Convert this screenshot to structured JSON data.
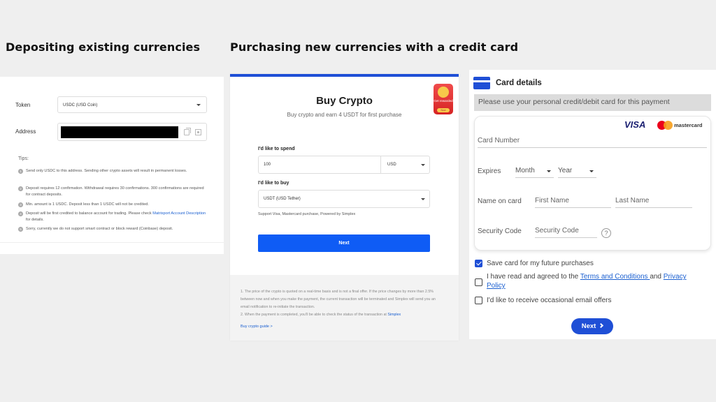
{
  "headings": {
    "left": "Depositing existing currencies",
    "right": "Purchasing new currencies with a credit card"
  },
  "deposit": {
    "token_label": "Token",
    "token_value": "USDC (USD Coin)",
    "address_label": "Address",
    "tips_label": "Tips:",
    "tips": [
      {
        "num": "1",
        "text": "Send only USDC to this address. Sending other crypto assets will result in permanent losses."
      },
      {
        "num": "2",
        "text": "Deposit requires 12 confirmation. Withdrawal requires 30 confirmations. 300 confirmations are required for contract deposits."
      },
      {
        "num": "3",
        "text": "Min. amount is 1 USDC. Deposit less than 1 USDC will not be credited."
      },
      {
        "num": "4",
        "text_prefix": "Deposit will be first credited to balance account for trading. Please check ",
        "link": "Matrixport Account Description",
        "text_suffix": " for details."
      },
      {
        "num": "5",
        "text": "Sorry, currently we do not support smart contract or block reward (Coinbase) deposit."
      }
    ]
  },
  "buy_crypto": {
    "title": "Buy Crypto",
    "subtitle": "Buy crypto and earn 4 USDT for first purchase",
    "promo_text": "Get rewarded",
    "promo_button": "Now",
    "spend_label": "I'd like to spend",
    "spend_value": "100",
    "spend_currency": "USD",
    "buy_label": "I'd like to buy",
    "buy_value": "USDT (USD Tether)",
    "support_text": "Support Visa, Mastercard purchase, Powered by Simplex",
    "next_label": "Next",
    "note_1": "1. The price of the crypto is quoted on a real-time basis and is not a final offer. If the price changes by more than 2.5% between now and when you make the payment, the current transaction will be terminated and Simplex will send you an email notification to re-initiate the transaction.",
    "note_2_prefix": "2. When the payment is completed, you'll be able to check the status of the transaction at ",
    "note_2_link": "Simplex",
    "guide_link": "Buy crypto guide >"
  },
  "card": {
    "title": "Card details",
    "banner": "Please use your personal credit/debit card for this payment",
    "brand_visa": "VISA",
    "brand_mastercard": "mastercard",
    "card_number_placeholder": "Card Number",
    "expires_label": "Expires",
    "month_placeholder": "Month",
    "year_placeholder": "Year",
    "name_label": "Name on card",
    "first_name_placeholder": "First Name",
    "last_name_placeholder": "Last Name",
    "security_label": "Security Code",
    "security_placeholder": "Security Code",
    "help_glyph": "?",
    "save_card": "Save card for my future purchases",
    "terms_prefix": "I have read and agreed to the ",
    "terms_link": "Terms and Conditions ",
    "terms_and": "and ",
    "privacy_link": "Privacy Policy",
    "email_offers": "I'd like to receive occasional email offers",
    "next_label": "Next",
    "save_card_checked": true,
    "terms_checked": false,
    "email_checked": false
  },
  "colors": {
    "accent": "#1f4fd6",
    "button_blue": "#0f5cf5",
    "background": "#efefef"
  }
}
